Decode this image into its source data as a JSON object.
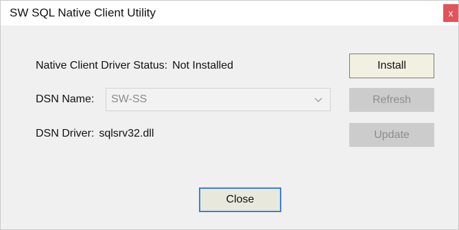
{
  "window": {
    "title": "SW SQL Native Client Utility",
    "close_glyph": "x"
  },
  "status": {
    "label": "Native Client Driver Status:",
    "value": "Not Installed"
  },
  "dsn_name": {
    "label": "DSN Name:",
    "value": "SW-SS",
    "arrow_icon": "chevron-down-icon"
  },
  "dsn_driver": {
    "label": "DSN Driver:",
    "value": "sqlsrv32.dll"
  },
  "buttons": {
    "install": "Install",
    "refresh": "Refresh",
    "update": "Update",
    "close": "Close"
  },
  "colors": {
    "close_x_bg": "#e0545a",
    "close_button_border": "#3c7fd6",
    "disabled_button_bg": "#cccccc"
  }
}
